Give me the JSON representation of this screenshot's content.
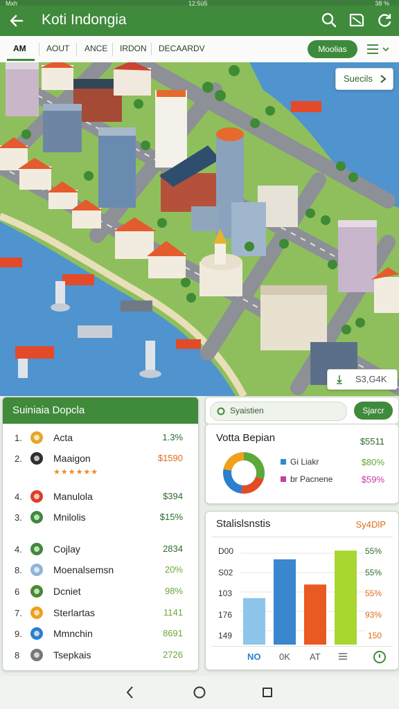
{
  "status_bar": {
    "left": "Mxh",
    "center": "12:5ü5",
    "right": "38 %"
  },
  "app": {
    "title": "Koti Indongia"
  },
  "icons": {
    "back": "arrow-left-icon",
    "search": "search-icon",
    "map": "map-icon",
    "refresh": "refresh-icon",
    "menu": "menu-icon",
    "chevron": "chevron-right-icon"
  },
  "tabs": [
    "AM",
    "AOUT",
    "ANCE",
    "IRDON",
    "DECAARDV"
  ],
  "filter_button": "Moolias",
  "map": {
    "top_chip": "Suecils",
    "bottom_chip": "S3,G4K"
  },
  "leaderboard": {
    "title": "Suiniaia Dopcla",
    "rows": [
      {
        "rank": "1.",
        "name": "Acta",
        "value": "1.3%",
        "color": "#2c6b2b"
      },
      {
        "rank": "2.",
        "name": "Maaigon",
        "value": "$1590",
        "color": "#e06a1b",
        "stars": "★★★★★★"
      },
      {
        "rank": "4.",
        "name": "Manulola",
        "value": "$394",
        "color": "#2c6b2b"
      },
      {
        "rank": "3.",
        "name": "Mnilolis",
        "value": "$15%",
        "color": "#2c6b2b"
      },
      {
        "rank": "4.",
        "name": "Cojlay",
        "value": "2834",
        "color": "#2c6b2b"
      },
      {
        "rank": "8.",
        "name": "Moenalsemsn",
        "value": "20%",
        "color": "#6aa63a"
      },
      {
        "rank": "6",
        "name": "Dcniet",
        "value": "98%",
        "color": "#6aa63a"
      },
      {
        "rank": "7.",
        "name": "Sterlartas",
        "value": "1141",
        "color": "#6aa63a"
      },
      {
        "rank": "9.",
        "name": "Mmnchin",
        "value": "8691",
        "color": "#6aa63a"
      },
      {
        "rank": "8",
        "name": "Tsepkais",
        "value": "2726",
        "color": "#6aa63a"
      }
    ]
  },
  "search_card": {
    "field": "Syaistien",
    "button": "Sjarcr"
  },
  "donut_card": {
    "title": "Votta Bepian",
    "total": "$5511",
    "legend": [
      {
        "label": "Gi Liakr",
        "value": "$80%",
        "color": "#6aa63a",
        "dot": "#2c8ad0"
      },
      {
        "label": "br Pacnene",
        "value": "$59%",
        "color": "#c83ca0",
        "dot": "#c83ca0"
      }
    ],
    "slices": [
      {
        "name": "green",
        "value": 30,
        "color": "#5da83b"
      },
      {
        "name": "red",
        "value": 22,
        "color": "#e24b25"
      },
      {
        "name": "blue",
        "value": 26,
        "color": "#2b7fcc"
      },
      {
        "name": "orange",
        "value": 22,
        "color": "#f0a01d"
      }
    ]
  },
  "stats_card": {
    "title": "Stalislsnstis",
    "subtitle": "Sy4DlP",
    "y_labels": [
      "D00",
      "S02",
      "103",
      "176",
      "149"
    ],
    "pct_labels": [
      {
        "text": "55%",
        "color": "#2c6b2b"
      },
      {
        "text": "55%",
        "color": "#2c6b2b"
      },
      {
        "text": "55%",
        "color": "#e06a1b"
      },
      {
        "text": "93%",
        "color": "#e06a1b"
      },
      {
        "text": "150",
        "color": "#e06a1b"
      }
    ],
    "footer": [
      "NO",
      "0K",
      "AT"
    ]
  },
  "chart_data": {
    "type": "bar",
    "title": "Stalislsnstis",
    "categories": [
      "",
      "",
      "",
      ""
    ],
    "values": [
      48,
      88,
      62,
      97
    ],
    "colors": [
      "#8ec5ea",
      "#3a86cf",
      "#e85a22",
      "#a9d630"
    ],
    "ylim": [
      0,
      100
    ],
    "grid": true
  }
}
